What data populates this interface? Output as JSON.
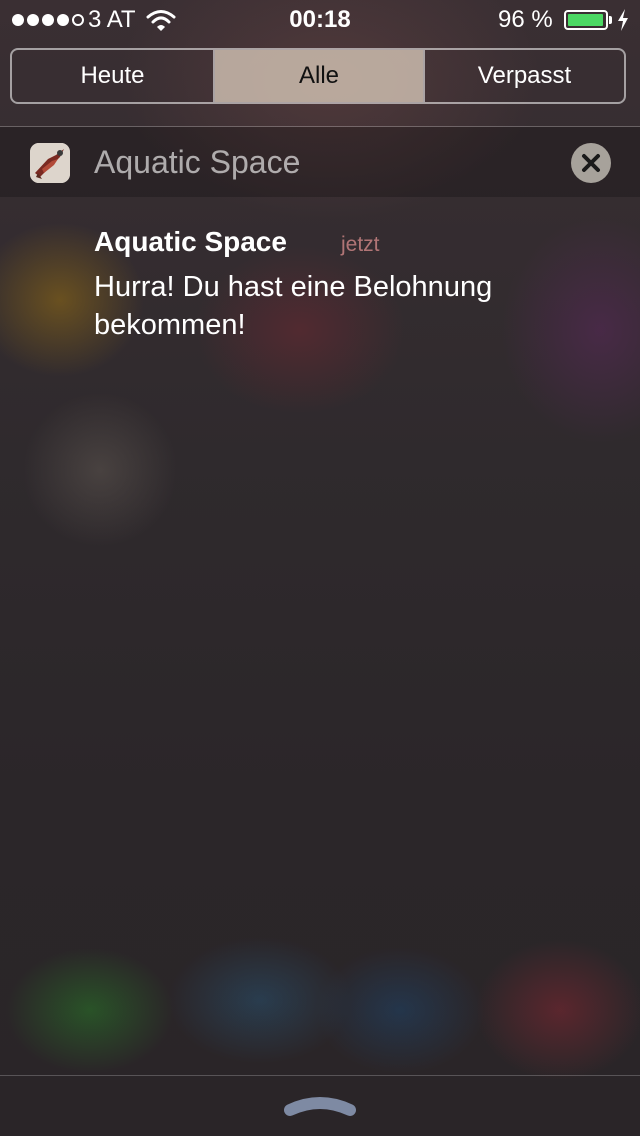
{
  "status_bar": {
    "signal_bars_filled": 4,
    "signal_bars_total": 5,
    "carrier": "3 AT",
    "wifi_icon": "wifi-icon",
    "time": "00:18",
    "battery_percent_text": "96 %",
    "battery_level": 0.96,
    "battery_color": "#4cd964",
    "charging_icon": "bolt-icon"
  },
  "tabs": [
    {
      "label": "Heute",
      "selected": false
    },
    {
      "label": "Alle",
      "selected": true
    },
    {
      "label": "Verpasst",
      "selected": false
    }
  ],
  "notification_group": {
    "app_icon": "app-icon",
    "app_name": "Aquatic Space",
    "clear_icon": "close-icon"
  },
  "notification": {
    "title": "Aquatic Space",
    "time": "jetzt",
    "message": "Hurra! Du hast eine Belohnung bekommen!"
  },
  "footer": {
    "grabber_icon": "chevron-up-icon"
  }
}
